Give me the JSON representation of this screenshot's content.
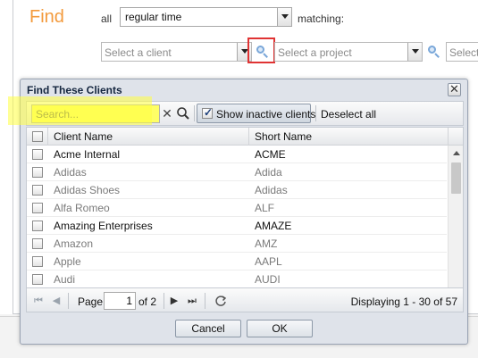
{
  "filter_bar": {
    "find_title": "Find",
    "all_label": "all",
    "time_select": "regular time",
    "matching_label": "matching:",
    "client_placeholder": "Select a client",
    "project_placeholder": "Select a project",
    "extra_placeholder": "Select"
  },
  "dialog": {
    "title": "Find These Clients",
    "close_label": "✕",
    "search_placeholder": "Search...",
    "clear_symbol": "✕",
    "show_inactive_label": "Show inactive clients",
    "show_inactive_checked": true,
    "deselect_label": "Deselect all",
    "columns": [
      "Client Name",
      "Short Name"
    ],
    "rows": [
      {
        "name": "Acme Internal",
        "short": "ACME",
        "active": true
      },
      {
        "name": "Adidas",
        "short": "Adida",
        "active": false
      },
      {
        "name": "Adidas Shoes",
        "short": "Adidas",
        "active": false
      },
      {
        "name": "Alfa Romeo",
        "short": "ALF",
        "active": false
      },
      {
        "name": "Amazing Enterprises",
        "short": "AMAZE",
        "active": true
      },
      {
        "name": "Amazon",
        "short": "AMZ",
        "active": false
      },
      {
        "name": "Apple",
        "short": "AAPL",
        "active": false
      },
      {
        "name": "Audi",
        "short": "AUDI",
        "active": false
      }
    ],
    "pager": {
      "page_label": "Page",
      "page_value": "1",
      "of_label": "of 2",
      "display_text": "Displaying 1 - 30 of 57"
    },
    "cancel_label": "Cancel",
    "ok_label": "OK"
  },
  "colors": {
    "accent_orange": "#f39a3c",
    "highlight_yellow": "#ffff66",
    "callout_red": "#e03333"
  }
}
